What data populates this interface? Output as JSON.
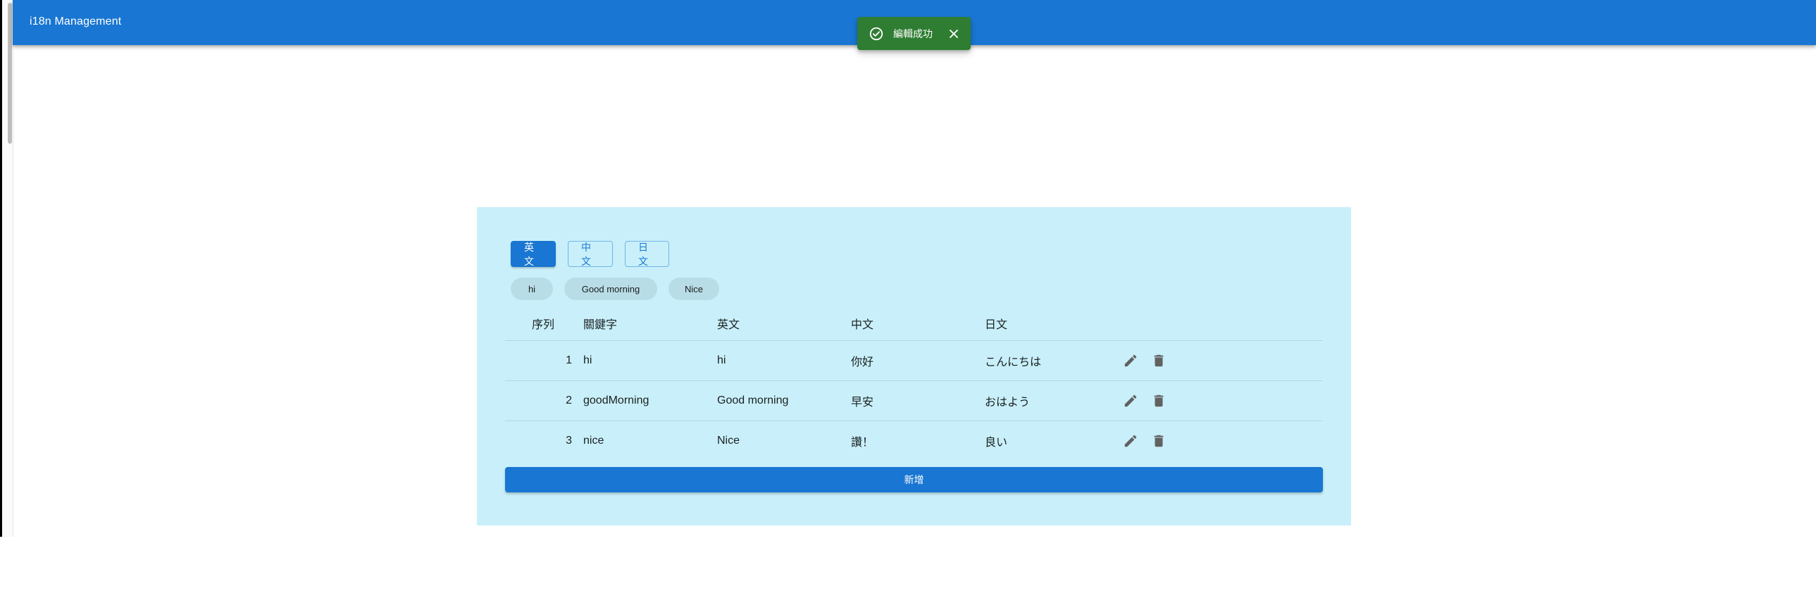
{
  "app": {
    "title": "i18n Management"
  },
  "snackbar": {
    "message": "編輯成功",
    "icon": "check-circle-icon",
    "close_icon": "close-icon",
    "color": "#2e7d32"
  },
  "colors": {
    "primary": "#1976d2",
    "panel_bg": "#c9f0fa"
  },
  "language_tabs": [
    {
      "label": "英文",
      "active": true
    },
    {
      "label": "中文",
      "active": false
    },
    {
      "label": "日文",
      "active": false
    }
  ],
  "chips": [
    "hi",
    "Good morning",
    "Nice"
  ],
  "table": {
    "headers": {
      "index": "序列",
      "key": "關鍵字",
      "en": "英文",
      "zh": "中文",
      "ja": "日文"
    },
    "rows": [
      {
        "index": "1",
        "key": "hi",
        "en": "hi",
        "zh": "你好",
        "ja": "こんにちは"
      },
      {
        "index": "2",
        "key": "goodMorning",
        "en": "Good morning",
        "zh": "早安",
        "ja": "おはよう"
      },
      {
        "index": "3",
        "key": "nice",
        "en": "Nice",
        "zh": "讚！",
        "ja": "良い"
      }
    ],
    "row_actions": {
      "edit_icon": "pencil-icon",
      "delete_icon": "trash-icon"
    }
  },
  "add_button": {
    "label": "新增"
  }
}
